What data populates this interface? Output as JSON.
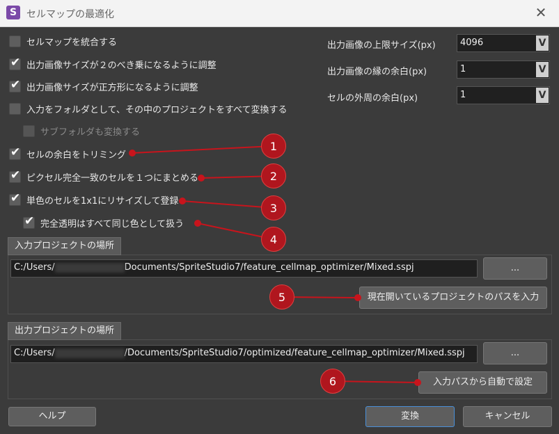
{
  "window": {
    "title": "セルマップの最適化",
    "close_glyph": "✕"
  },
  "options": [
    {
      "label": "セルマップを統合する",
      "checked": false
    },
    {
      "label": "出力画像サイズが２のべき乗になるように調整",
      "checked": true
    },
    {
      "label": "出力画像サイズが正方形になるように調整",
      "checked": true
    },
    {
      "label": "入力をフォルダとして、その中のプロジェクトをすべて変換する",
      "checked": false
    },
    {
      "label": "サブフォルダも変換する",
      "checked": false,
      "disabled": true
    },
    {
      "label": "セルの余白をトリミング",
      "checked": true
    },
    {
      "label": "ピクセル完全一致のセルを１つにまとめる",
      "checked": true
    },
    {
      "label": "単色のセルを1x1にリサイズして登録",
      "checked": true
    },
    {
      "label": "完全透明はすべて同じ色として扱う",
      "checked": true
    }
  ],
  "fields": {
    "max_size": {
      "label": "出力画像の上限サイズ(px)",
      "value": "4096"
    },
    "edge_margin": {
      "label": "出力画像の縁の余白(px)",
      "value": "1"
    },
    "cell_margin": {
      "label": "セルの外周の余白(px)",
      "value": "1"
    },
    "arrow_glyph": "V"
  },
  "input": {
    "tab_label": "入力プロジェクトの場所",
    "path_prefix": "C:/Users/",
    "path_suffix": "Documents/SpriteStudio7/feature_cellmap_optimizer/Mixed.sspj",
    "browse_label": "...",
    "use_current_label": "現在開いているプロジェクトのパスを入力"
  },
  "output": {
    "tab_label": "出力プロジェクトの場所",
    "path_prefix": "C:/Users/",
    "path_suffix": "/Documents/SpriteStudio7/optimized/feature_cellmap_optimizer/Mixed.sspj",
    "browse_label": "...",
    "auto_label": "入力パスから自動で設定"
  },
  "footer": {
    "help_label": "ヘルプ",
    "convert_label": "変換",
    "cancel_label": "キャンセル"
  },
  "markers": [
    "1",
    "2",
    "3",
    "4",
    "5",
    "6"
  ],
  "colors": {
    "marker": "#c8141c",
    "accent": "#4a90d9"
  }
}
